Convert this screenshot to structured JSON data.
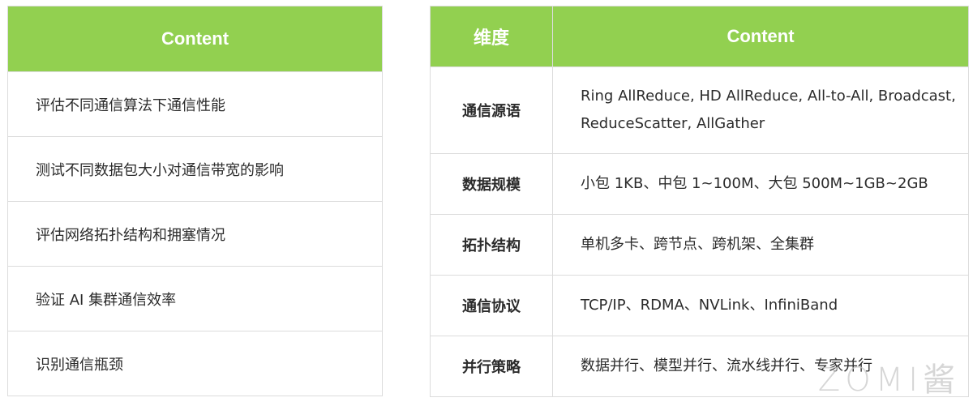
{
  "left_table": {
    "header": "Content",
    "rows": [
      "评估不同通信算法下通信性能",
      "测试不同数据包大小对通信带宽的影响",
      "评估网络拓扑结构和拥塞情况",
      "验证 AI 集群通信效率",
      "识别通信瓶颈"
    ]
  },
  "right_table": {
    "headers": {
      "dimension": "维度",
      "content": "Content"
    },
    "rows": [
      {
        "dimension": "通信源语",
        "content": "Ring AllReduce, HD AllReduce, All-to-All, Broadcast, ReduceScatter, AllGather"
      },
      {
        "dimension": "数据规模",
        "content": "小包 1KB、中包 1~100M、大包 500M~1GB~2GB"
      },
      {
        "dimension": "拓扑结构",
        "content": "单机多卡、跨节点、跨机架、全集群"
      },
      {
        "dimension": "通信协议",
        "content": "TCP/IP、RDMA、NVLink、InfiniBand"
      },
      {
        "dimension": "并行策略",
        "content": "数据并行、模型并行、流水线并行、专家并行"
      }
    ]
  },
  "watermark": "ZOMI酱",
  "colors": {
    "header_bg": "#92d050",
    "header_text": "#ffffff",
    "border": "#dcdcdc"
  }
}
